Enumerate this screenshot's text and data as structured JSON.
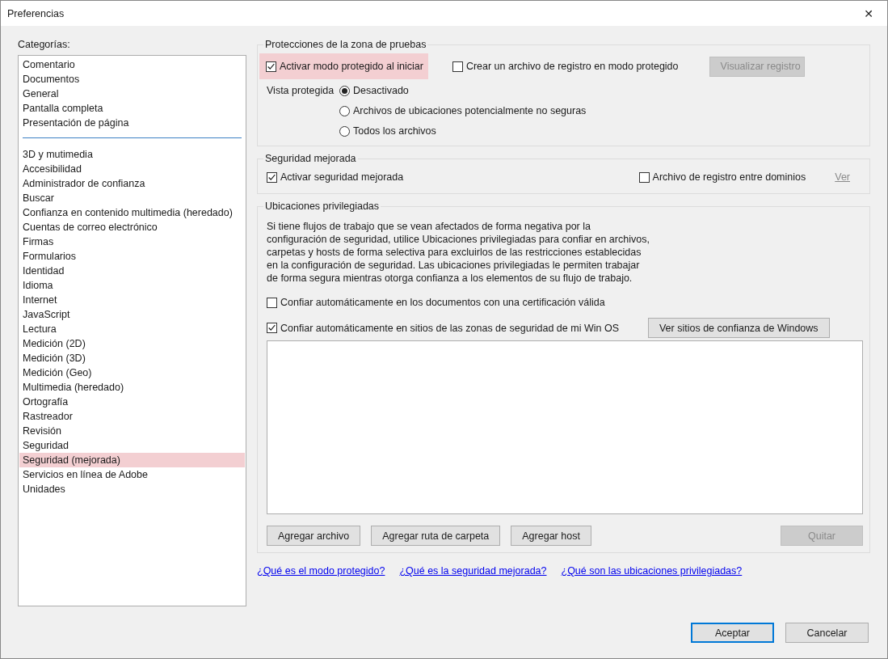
{
  "window": {
    "title": "Preferencias",
    "close": "✕"
  },
  "categories": {
    "label": "Categorías:",
    "groups": [
      {
        "items": [
          {
            "label": "Comentario",
            "selected": false
          },
          {
            "label": "Documentos",
            "selected": false
          },
          {
            "label": "General",
            "selected": false
          },
          {
            "label": "Pantalla completa",
            "selected": false
          },
          {
            "label": "Presentación de página",
            "selected": false
          }
        ]
      },
      {
        "items": [
          {
            "label": "3D y mutimedia",
            "selected": false
          },
          {
            "label": "Accesibilidad",
            "selected": false
          },
          {
            "label": "Administrador de confianza",
            "selected": false
          },
          {
            "label": "Buscar",
            "selected": false
          },
          {
            "label": "Confianza en contenido multimedia (heredado)",
            "selected": false
          },
          {
            "label": "Cuentas de correo electrónico",
            "selected": false
          },
          {
            "label": "Firmas",
            "selected": false
          },
          {
            "label": "Formularios",
            "selected": false
          },
          {
            "label": "Identidad",
            "selected": false
          },
          {
            "label": "Idioma",
            "selected": false
          },
          {
            "label": "Internet",
            "selected": false
          },
          {
            "label": "JavaScript",
            "selected": false
          },
          {
            "label": "Lectura",
            "selected": false
          },
          {
            "label": "Medición (2D)",
            "selected": false
          },
          {
            "label": "Medición (3D)",
            "selected": false
          },
          {
            "label": "Medición (Geo)",
            "selected": false
          },
          {
            "label": "Multimedia (heredado)",
            "selected": false
          },
          {
            "label": "Ortografía",
            "selected": false
          },
          {
            "label": "Rastreador",
            "selected": false
          },
          {
            "label": "Revisión",
            "selected": false
          },
          {
            "label": "Seguridad",
            "selected": false
          },
          {
            "label": "Seguridad (mejorada)",
            "selected": true
          },
          {
            "label": "Servicios en línea de Adobe",
            "selected": false
          },
          {
            "label": "Unidades",
            "selected": false
          }
        ]
      }
    ]
  },
  "sandbox": {
    "title": "Protecciones de la zona de pruebas",
    "protected_mode": {
      "label": "Activar modo protegido al iniciar",
      "checked": true,
      "highlighted": true
    },
    "log": {
      "label": "Crear un archivo de registro en modo protegido",
      "checked": false
    },
    "view_log": {
      "label": "Visualizar registro",
      "disabled": true
    },
    "protected_view": {
      "label": "Vista protegida",
      "options": [
        {
          "label": "Desactivado",
          "selected": true
        },
        {
          "label": "Archivos de ubicaciones potencialmente no seguras",
          "selected": false
        },
        {
          "label": "Todos los archivos",
          "selected": false
        }
      ]
    }
  },
  "enhanced": {
    "title": "Seguridad mejorada",
    "enable": {
      "label": "Activar seguridad mejorada",
      "checked": true
    },
    "cross_domain": {
      "label": "Archivo de registro entre dominios",
      "checked": false
    },
    "view": {
      "label": "Ver",
      "disabled": true
    }
  },
  "privileged": {
    "title": "Ubicaciones privilegiadas",
    "description": "Si tiene flujos de trabajo que se vean afectados de forma negativa por la configuración de seguridad, utilice Ubicaciones privilegiadas para confiar en archivos, carpetas y hosts de forma selectiva para excluirlos de las restricciones establecidas en la configuración de seguridad. Las ubicaciones privilegiadas le permiten trabajar de forma segura mientras otorga confianza a los elementos de su flujo de trabajo.",
    "trust_certified": {
      "label": "Confiar automáticamente en los documentos con una certificación válida",
      "checked": false
    },
    "trust_os": {
      "label": "Confiar automáticamente en sitios de las zonas de seguridad de mi Win OS",
      "checked": true
    },
    "windows_sites": {
      "label": "Ver sitios de confianza de Windows"
    },
    "buttons": [
      {
        "label": "Agregar archivo",
        "disabled": false
      },
      {
        "label": "Agregar ruta de carpeta",
        "disabled": false
      },
      {
        "label": "Agregar host",
        "disabled": false
      },
      {
        "label": "Quitar",
        "disabled": true
      }
    ]
  },
  "links": [
    "¿Qué es el modo protegido?",
    "¿Qué es la seguridad mejorada?",
    "¿Qué son las ubicaciones privilegiadas?"
  ],
  "footer_buttons": [
    {
      "label": "Aceptar",
      "default": true
    },
    {
      "label": "Cancelar",
      "default": false
    }
  ]
}
